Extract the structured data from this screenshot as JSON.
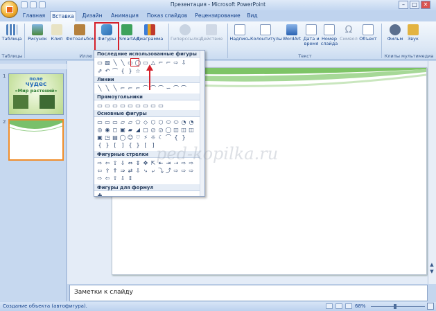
{
  "window": {
    "title": "Презентация - Microsoft PowerPoint",
    "minimize": "–",
    "maximize": "□",
    "close": "✕"
  },
  "tabs": [
    "Главная",
    "Вставка",
    "Дизайн",
    "Анимация",
    "Показ слайдов",
    "Рецензирование",
    "Вид"
  ],
  "active_tab": "Вставка",
  "ribbon": {
    "buttons": [
      "Таблица",
      "Рисунок",
      "Клип",
      "Фотоальбом",
      "Фигуры",
      "SmartArt",
      "Диаграмма",
      "Гиперссылка",
      "Действие",
      "Надпись",
      "Колонтитулы",
      "WordArt",
      "Дата и время",
      "Номер слайда",
      "Символ",
      "Объект",
      "Фильм",
      "Звук"
    ],
    "groups": [
      "Таблицы",
      "Иллю",
      "Текст",
      "Клипы мультимедиа"
    ]
  },
  "shapes_gallery": {
    "sections": [
      "Последние использованные фигуры",
      "Линии",
      "Прямоугольники",
      "Основные фигуры",
      "Фигурные стрелки",
      "Фигуры для формул"
    ],
    "rows": [
      "▭▧╲╲▭◯▭△⌐⌐⇨⇩",
      "⇗↶⌒{}☆",
      "╲╲╲⌐⌐⌐⌒⌒⌒∽⌒⌒⌒",
      "▭▭▭▭▭▭▭▭▭",
      "▭▭▭▱▱⬠◇⬡⬡⬭⬭◔◔",
      "◎◉◻▣▰◢▢◶◶◯◫◫◫",
      "▣◳▤◯☺♡⚡☼☾⌒{}",
      "{}[]{}[]",
      "⇨⇦⇧⇩⇔⇕✥⇱⇤⇥⇢⇨⇨",
      "⇦⇪⇑⇒⇄⇩⤷⤶⤵⤴⇨⇨⇨",
      "⇨⇦⇧⇩⇕",
      "✚"
    ]
  },
  "slides_panel": {
    "slide1_number": "1",
    "slide2_number": "2",
    "slide1_lines": [
      "поле",
      "чудес",
      "«Мир растений»"
    ]
  },
  "watermark": "ped-kopilka.ru",
  "notes_placeholder": "Заметки к слайду",
  "status": {
    "text": "Создание объекта (автофигура).",
    "zoom": "68%"
  },
  "colors": {
    "highlight_red": "#d5202a",
    "slide_accent": "#5fb34f",
    "ribbon_bg": "#dbe7f5"
  }
}
